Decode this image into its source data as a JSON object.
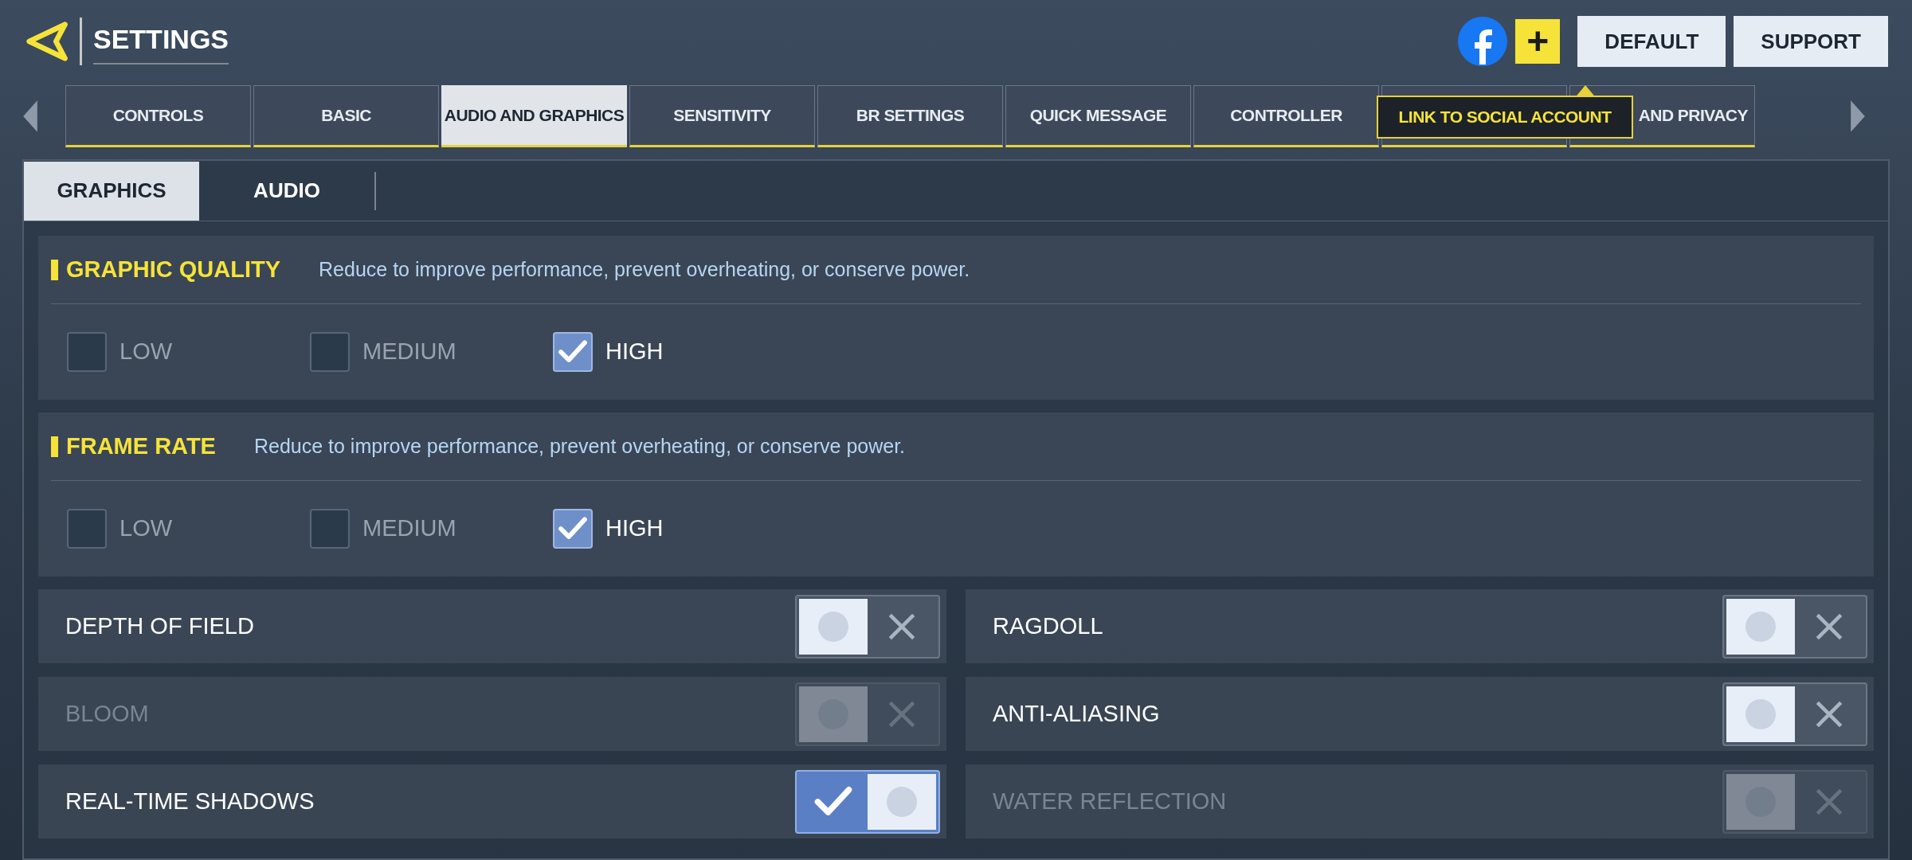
{
  "header": {
    "title": "SETTINGS",
    "buttons": [
      "DEFAULT",
      "SUPPORT"
    ],
    "add_button": "+",
    "tooltip": "LINK TO SOCIAL ACCOUNT"
  },
  "tabs": [
    {
      "label": "CONTROLS",
      "selected": false
    },
    {
      "label": "BASIC",
      "selected": false
    },
    {
      "label": "AUDIO AND GRAPHICS",
      "selected": true
    },
    {
      "label": "SENSITIVITY",
      "selected": false
    },
    {
      "label": "BR SETTINGS",
      "selected": false
    },
    {
      "label": "QUICK MESSAGE",
      "selected": false
    },
    {
      "label": "CONTROLLER",
      "selected": false
    },
    {
      "selected": false
    },
    {
      "label": "AND PRIVACY",
      "selected": false
    }
  ],
  "subtabs": [
    {
      "label": "GRAPHICS",
      "selected": true
    },
    {
      "label": "AUDIO",
      "selected": false
    }
  ],
  "sections": [
    {
      "title": "GRAPHIC QUALITY",
      "description": "Reduce to improve performance, prevent overheating, or conserve power.",
      "options": [
        {
          "label": "LOW",
          "checked": false
        },
        {
          "label": "MEDIUM",
          "checked": false
        },
        {
          "label": "HIGH",
          "checked": true
        }
      ]
    },
    {
      "title": "FRAME RATE",
      "description": "Reduce to improve performance, prevent overheating, or conserve power.",
      "options": [
        {
          "label": "LOW",
          "checked": false
        },
        {
          "label": "MEDIUM",
          "checked": false
        },
        {
          "label": "HIGH",
          "checked": true
        }
      ]
    }
  ],
  "toggles": [
    {
      "label": "DEPTH OF FIELD",
      "on": false,
      "disabled": false
    },
    {
      "label": "RAGDOLL",
      "on": false,
      "disabled": false
    },
    {
      "label": "BLOOM",
      "on": false,
      "disabled": true
    },
    {
      "label": "ANTI-ALIASING",
      "on": false,
      "disabled": false
    },
    {
      "label": "REAL-TIME SHADOWS",
      "on": true,
      "disabled": false
    },
    {
      "label": "WATER REFLECTION",
      "on": false,
      "disabled": true
    }
  ]
}
